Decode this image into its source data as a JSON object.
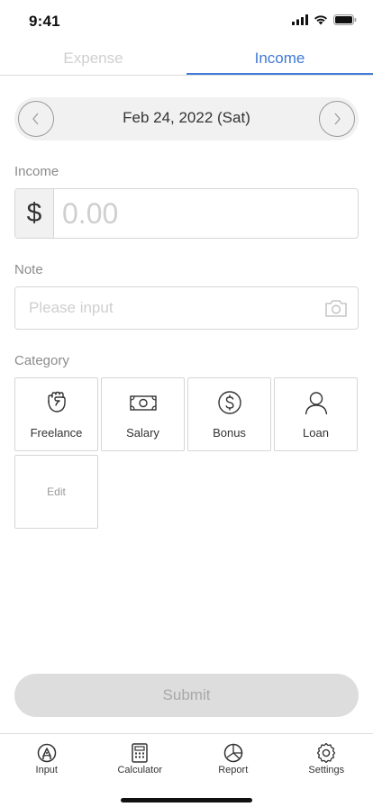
{
  "status_bar": {
    "time": "9:41"
  },
  "tabs": [
    {
      "label": "Expense",
      "active": false
    },
    {
      "label": "Income",
      "active": true
    }
  ],
  "date_selector": {
    "date": "Feb 24, 2022 (Sat)"
  },
  "income": {
    "label": "Income",
    "currency": "$",
    "placeholder": "0.00",
    "value": ""
  },
  "note": {
    "label": "Note",
    "placeholder": "Please input",
    "value": ""
  },
  "category": {
    "label": "Category",
    "items": [
      {
        "label": "Freelance",
        "icon": "fist-icon"
      },
      {
        "label": "Salary",
        "icon": "banknote-icon"
      },
      {
        "label": "Bonus",
        "icon": "dollar-coin-icon"
      },
      {
        "label": "Loan",
        "icon": "person-icon"
      }
    ],
    "edit_label": "Edit"
  },
  "submit_label": "Submit",
  "bottom_nav": [
    {
      "label": "Input",
      "icon": "pen-circle-icon"
    },
    {
      "label": "Calculator",
      "icon": "calculator-icon"
    },
    {
      "label": "Report",
      "icon": "pie-chart-icon"
    },
    {
      "label": "Settings",
      "icon": "gear-icon"
    }
  ],
  "colors": {
    "accent": "#3f7ad6",
    "inactive_text": "#cfcfcf",
    "border": "#d6d6d6",
    "submit_bg": "#dddddd"
  }
}
